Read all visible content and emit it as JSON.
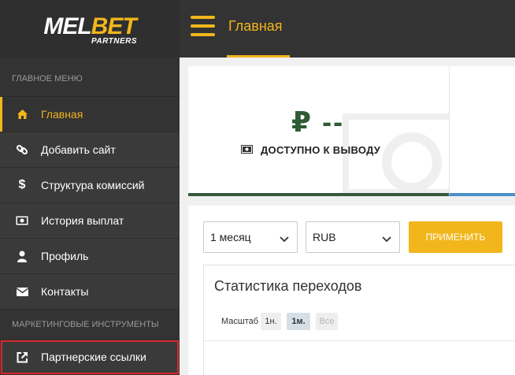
{
  "brand": {
    "logo_white": "MEL",
    "logo_yellow": "BET",
    "logo_sub": "PARTNERS"
  },
  "colors": {
    "accent": "#f2b61c",
    "sidebar_bg": "#3a3a3a",
    "amount_green": "#2f5b35",
    "highlight_red": "#d9262c",
    "card2_border": "#4a90c8"
  },
  "sidebar": {
    "main_menu_title": "ГЛАВНОЕ МЕНЮ",
    "items": [
      {
        "label": "Главная",
        "icon": "home-icon",
        "active": true
      },
      {
        "label": "Добавить сайт",
        "icon": "link-icon"
      },
      {
        "label": "Структура комиссий",
        "icon": "dollar-icon"
      },
      {
        "label": "История выплат",
        "icon": "money-icon"
      },
      {
        "label": "Профиль",
        "icon": "user-icon"
      },
      {
        "label": "Контакты",
        "icon": "envelope-icon"
      }
    ],
    "marketing_title": "МАРКЕТИНГОВЫЕ ИНСТРУМЕНТЫ",
    "marketing_items": [
      {
        "label": "Партнерские ссылки",
        "icon": "external-link-icon"
      }
    ]
  },
  "topbar": {
    "title": "Главная",
    "menu_icon": "hamburger-icon"
  },
  "balance_card": {
    "currency_symbol": "₽",
    "amount": "--",
    "label": "ДОСТУПНО К ВЫВОДУ",
    "icon": "cash-icon"
  },
  "filters": {
    "period": {
      "value": "1 месяц"
    },
    "currency": {
      "value": "RUB"
    },
    "apply_label": "ПРИМЕНИТЬ"
  },
  "stats": {
    "title": "Статистика переходов",
    "scale_label": "Масштаб",
    "scale_options": [
      "1н.",
      "1м.",
      "Все"
    ],
    "scale_selected": "1м."
  }
}
